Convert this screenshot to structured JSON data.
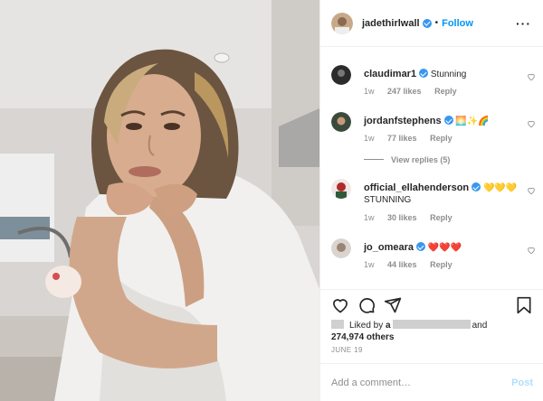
{
  "post": {
    "author": "jadethirlwall",
    "follow_label": "Follow",
    "separator": "•",
    "more_label": "···",
    "photo_alt": "selfie-photo"
  },
  "comments": [
    {
      "user": "claudimar1",
      "verified": true,
      "text": "Stunning",
      "emoji": "",
      "age": "1w",
      "likes": "247 likes",
      "reply": "Reply"
    },
    {
      "user": "jordanfstephens",
      "verified": true,
      "text": "",
      "emoji": "🌅✨🌈",
      "age": "1w",
      "likes": "77 likes",
      "reply": "Reply"
    },
    {
      "user": "official_ellahenderson",
      "verified": true,
      "text": "STUNNING",
      "emoji": "💛💛💛",
      "age": "1w",
      "likes": "30 likes",
      "reply": "Reply"
    },
    {
      "user": "jo_omeara",
      "verified": true,
      "text": "",
      "emoji": "❤️❤️❤️",
      "age": "1w",
      "likes": "44 likes",
      "reply": "Reply"
    }
  ],
  "view_replies": "View replies (5)",
  "likes": {
    "liked_by_prefix": "Liked by",
    "liked_by_initial": "a",
    "and": "and",
    "others": "274,974 others"
  },
  "date": "JUNE 19",
  "add_comment": {
    "placeholder": "Add a comment…",
    "post_label": "Post"
  },
  "colors": {
    "accent": "#0095f6",
    "verified": "#3897f0",
    "muted": "#8e8e8e",
    "post_disabled": "#b2dffc",
    "heart_red": "#e0245e"
  }
}
